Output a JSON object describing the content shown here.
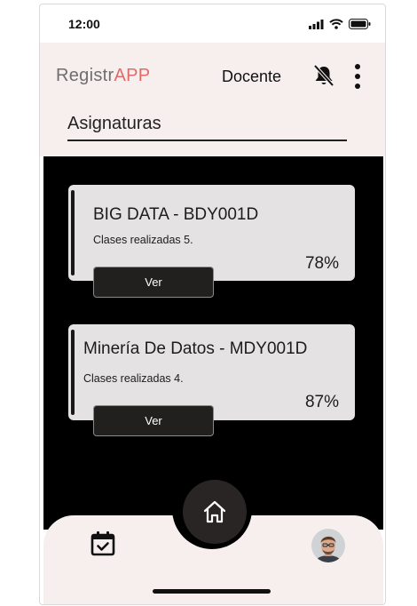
{
  "status_bar": {
    "time": "12:00",
    "signal_icon": "signal-icon",
    "wifi_icon": "wifi-icon",
    "battery_icon": "battery-icon"
  },
  "header": {
    "brand_prefix": "Registr",
    "brand_suffix": "APP",
    "role": "Docente",
    "notifications_icon": "bell-off-icon",
    "menu_icon": "more-vertical-icon"
  },
  "section": {
    "title": "Asignaturas"
  },
  "courses": [
    {
      "title": "BIG DATA - BDY001D",
      "subtitle": "Clases realizadas 5.",
      "percent": "78%",
      "button": "Ver"
    },
    {
      "title": "Minería De Datos - MDY001D",
      "subtitle": "Clases realizadas 4.",
      "percent": "87%",
      "button": "Ver"
    }
  ],
  "bottom_nav": {
    "home_icon": "home-icon",
    "calendar_icon": "calendar-check-icon",
    "avatar": "profile-avatar"
  },
  "colors": {
    "header_bg": "#f6efed",
    "content_bg": "#000000",
    "card_bg": "#e4e2e2",
    "accent": "#e06b6b",
    "button_bg": "#221f1f"
  }
}
